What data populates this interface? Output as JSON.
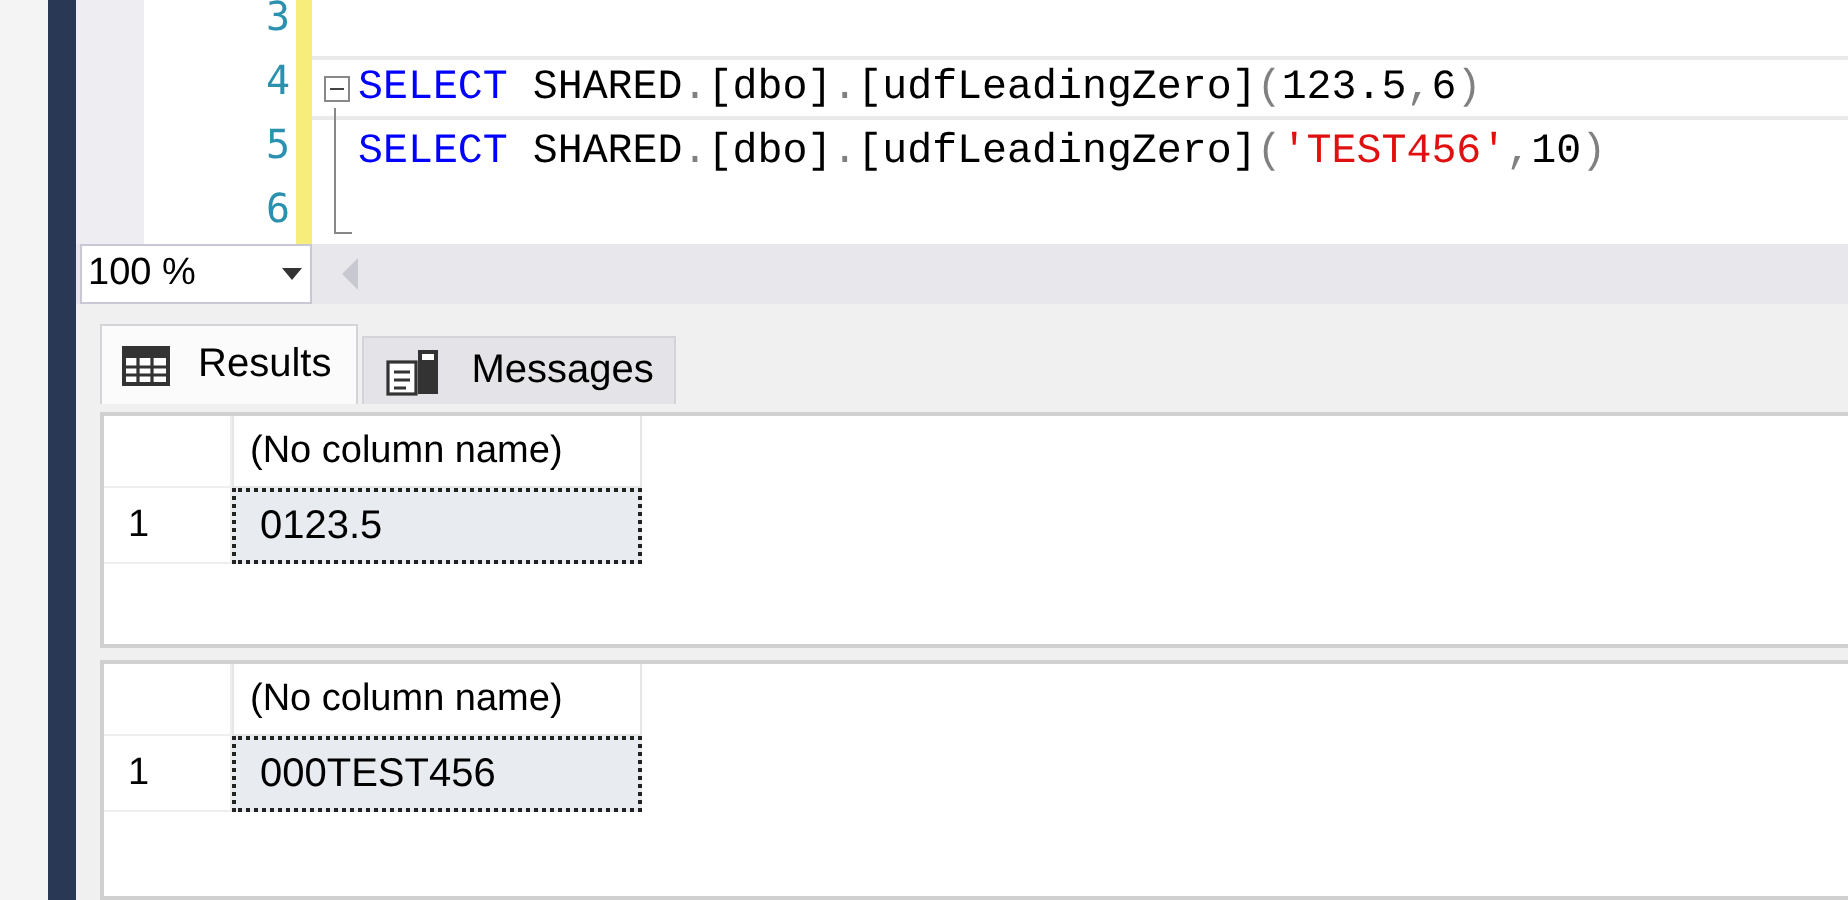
{
  "editor": {
    "lines": [
      {
        "number": "3",
        "current": false,
        "collapse": false
      },
      {
        "number": "4",
        "current": true,
        "collapse": true,
        "tokens": [
          {
            "kind": "keyword",
            "text": "SELECT"
          },
          {
            "kind": "plain",
            "text": " SHARED"
          },
          {
            "kind": "punct",
            "text": "."
          },
          {
            "kind": "plain",
            "text": "[dbo]"
          },
          {
            "kind": "punct",
            "text": "."
          },
          {
            "kind": "plain",
            "text": "[udfLeadingZero]"
          },
          {
            "kind": "punct",
            "text": "("
          },
          {
            "kind": "plain",
            "text": "123.5"
          },
          {
            "kind": "punct",
            "text": ","
          },
          {
            "kind": "plain",
            "text": "6"
          },
          {
            "kind": "punct",
            "text": ")"
          }
        ]
      },
      {
        "number": "5",
        "current": false,
        "collapse": false,
        "tokens": [
          {
            "kind": "keyword",
            "text": "SELECT"
          },
          {
            "kind": "plain",
            "text": " SHARED"
          },
          {
            "kind": "punct",
            "text": "."
          },
          {
            "kind": "plain",
            "text": "[dbo]"
          },
          {
            "kind": "punct",
            "text": "."
          },
          {
            "kind": "plain",
            "text": "[udfLeadingZero]"
          },
          {
            "kind": "punct",
            "text": "("
          },
          {
            "kind": "string",
            "text": "'TEST456'"
          },
          {
            "kind": "punct",
            "text": ","
          },
          {
            "kind": "plain",
            "text": "10"
          },
          {
            "kind": "punct",
            "text": ")"
          }
        ]
      },
      {
        "number": "6",
        "current": false,
        "collapse": false
      }
    ]
  },
  "zoom": {
    "value": "100 %"
  },
  "tabs": [
    {
      "label": "Results",
      "selected": true
    },
    {
      "label": "Messages",
      "selected": false
    }
  ],
  "result_sets": [
    {
      "columns": [
        "(No column name)"
      ],
      "rows": [
        {
          "number": "1",
          "cells": [
            {
              "text": "0123.5",
              "selected": true
            }
          ]
        }
      ]
    },
    {
      "columns": [
        "(No column name)"
      ],
      "rows": [
        {
          "number": "1",
          "cells": [
            {
              "text": "000TEST456",
              "selected": true
            }
          ]
        }
      ]
    }
  ]
}
